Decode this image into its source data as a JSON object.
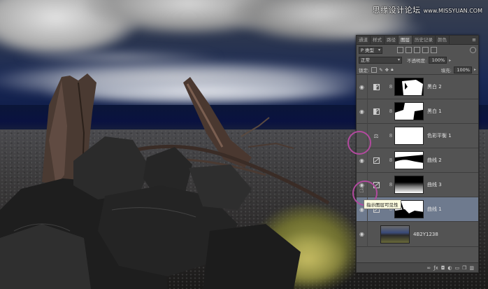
{
  "watermark": {
    "text": "思缘设计论坛",
    "url": "www.MISSYUAN.COM"
  },
  "panel": {
    "tabs": [
      {
        "label": "通道",
        "active": false
      },
      {
        "label": "样式",
        "active": false
      },
      {
        "label": "路径",
        "active": false
      },
      {
        "label": "图层",
        "active": true
      },
      {
        "label": "历史记录",
        "active": false
      },
      {
        "label": "颜色",
        "active": false
      }
    ],
    "filter_kind": "P 类型",
    "blend_mode": "正常",
    "opacity_label": "不透明度:",
    "opacity_value": "100%",
    "lock_label": "锁定:",
    "fill_label": "填充:",
    "fill_value": "100%",
    "layers": [
      {
        "name": "黑白 2",
        "visible": true,
        "adjustment": "bw",
        "selected": false
      },
      {
        "name": "黑白 1",
        "visible": true,
        "adjustment": "bw",
        "selected": false
      },
      {
        "name": "色彩平衡 1",
        "visible": false,
        "adjustment": "color-balance",
        "selected": false
      },
      {
        "name": "曲线 2",
        "visible": true,
        "adjustment": "curves",
        "selected": false
      },
      {
        "name": "曲线 3",
        "visible": true,
        "adjustment": "curves",
        "selected": false
      },
      {
        "name": "曲线 1",
        "visible": true,
        "adjustment": "curves",
        "selected": true
      },
      {
        "name": "4B2Y1238",
        "visible": true,
        "adjustment": "none",
        "selected": false
      }
    ],
    "tooltip": "指示图层可见性"
  },
  "icons": {
    "eye": "eye-icon",
    "chain": "chain-link-icon",
    "curves": "curves-adjustment-icon",
    "bw": "black-white-adjustment-icon",
    "color_balance": "color-balance-icon"
  },
  "colors": {
    "selected_row": "#6e7a8e",
    "annotation": "#b24a9e",
    "panel": "#535353"
  }
}
